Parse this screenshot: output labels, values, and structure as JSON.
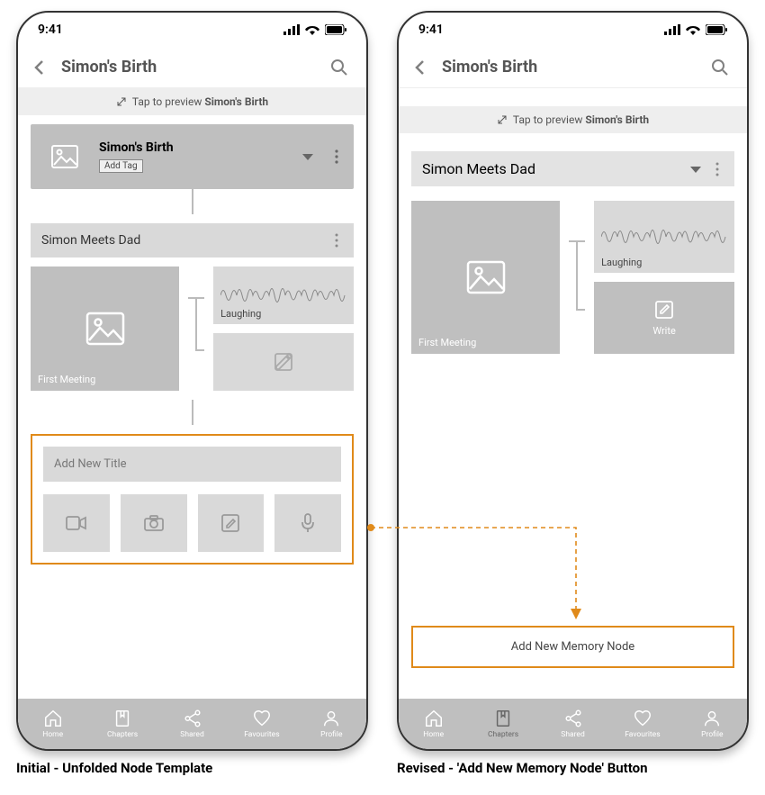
{
  "status": {
    "time": "9:41"
  },
  "header": {
    "title": "Simon's Birth"
  },
  "preview": {
    "prefix": "Tap to preview ",
    "bold": "Simon's Birth"
  },
  "chapter": {
    "name": "Simon's Birth",
    "add_tag": "Add Tag"
  },
  "sub": {
    "title": "Simon Meets Dad"
  },
  "media": {
    "first_meeting": "First Meeting",
    "laughing": "Laughing",
    "write": "Write"
  },
  "add_block": {
    "title_placeholder": "Add New Title"
  },
  "revised": {
    "button": "Add New Memory Node"
  },
  "tabs": {
    "home": "Home",
    "chapters": "Chapters",
    "shared": "Shared",
    "favourites": "Favourites",
    "profile": "Profile"
  },
  "captions": {
    "left": "Initial - Unfolded Node Template",
    "right": "Revised - 'Add New Memory Node' Button"
  }
}
